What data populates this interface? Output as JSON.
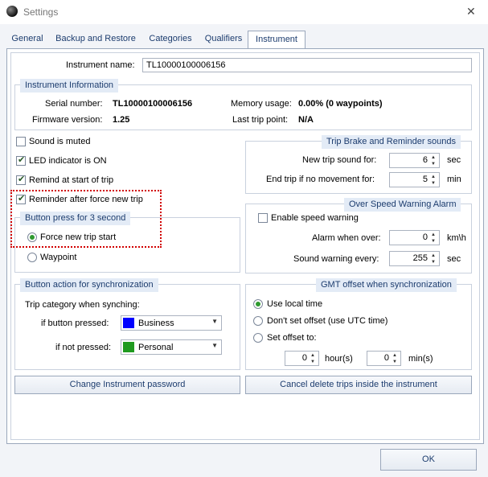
{
  "window": {
    "title": "Settings",
    "close_glyph": "✕"
  },
  "tabs": [
    {
      "label": "General"
    },
    {
      "label": "Backup and Restore"
    },
    {
      "label": "Categories"
    },
    {
      "label": "Qualifiers"
    },
    {
      "label": "Instrument",
      "active": true
    }
  ],
  "instrument_name": {
    "label": "Instrument name:",
    "value": "TL10000100006156"
  },
  "instrument_info": {
    "title": "Instrument Information",
    "serial_label": "Serial number:",
    "serial_value": "TL10000100006156",
    "firmware_label": "Firmware version:",
    "firmware_value": "1.25",
    "memory_label": "Memory usage:",
    "memory_value": "0.00% (0 waypoints)",
    "last_trip_label": "Last trip point:",
    "last_trip_value": "N/A"
  },
  "options": {
    "sound_muted": {
      "label": "Sound is muted",
      "checked": false
    },
    "led_on": {
      "label": "LED indicator is ON",
      "checked": true
    },
    "remind_start": {
      "label": "Remind at start of trip",
      "checked": true
    },
    "reminder_force": {
      "label": "Reminder after force new trip",
      "checked": true
    }
  },
  "button_press": {
    "title": "Button press for 3 second",
    "force_new_trip": {
      "label": "Force new trip start",
      "selected": true
    },
    "waypoint": {
      "label": "Waypoint",
      "selected": false
    }
  },
  "trip_brake": {
    "title": "Trip Brake and Reminder sounds",
    "new_trip_label": "New trip sound for:",
    "new_trip_value": "6",
    "new_trip_unit": "sec",
    "end_trip_label": "End trip if no movement for:",
    "end_trip_value": "5",
    "end_trip_unit": "min"
  },
  "over_speed": {
    "title": "Over Speed Warning Alarm",
    "enable_label": "Enable speed warning",
    "enable_checked": false,
    "alarm_label": "Alarm when over:",
    "alarm_value": "0",
    "alarm_unit": "km\\h",
    "sound_label": "Sound warning every:",
    "sound_value": "255",
    "sound_unit": "sec"
  },
  "sync_action": {
    "title": "Button action for synchronization",
    "trip_category_label": "Trip category when synching:",
    "if_pressed_label": "if button pressed:",
    "if_pressed_value": "Business",
    "if_pressed_color": "#0000ff",
    "if_not_pressed_label": "if not pressed:",
    "if_not_pressed_value": "Personal",
    "if_not_pressed_color": "#1f9a1f"
  },
  "gmt": {
    "title": "GMT offset when synchronization",
    "use_local": {
      "label": "Use local time",
      "selected": true
    },
    "dont_set": {
      "label": "Don't set offset (use UTC time)",
      "selected": false
    },
    "set_offset": {
      "label": "Set offset to:",
      "selected": false
    },
    "hours_value": "0",
    "hours_unit": "hour(s)",
    "minutes_value": "0",
    "minutes_unit": "min(s)"
  },
  "buttons": {
    "change_password": "Change Instrument password",
    "cancel_delete": "Cancel delete trips inside the instrument",
    "ok": "OK"
  },
  "icons": {
    "check": "✔",
    "spin_up": "▲",
    "spin_down": "▼",
    "dropdown": "▼"
  },
  "colors": {
    "accent_text": "#1c3c6e",
    "group_title_bg": "#e3ebf6",
    "highlight_box": "#d10000"
  }
}
